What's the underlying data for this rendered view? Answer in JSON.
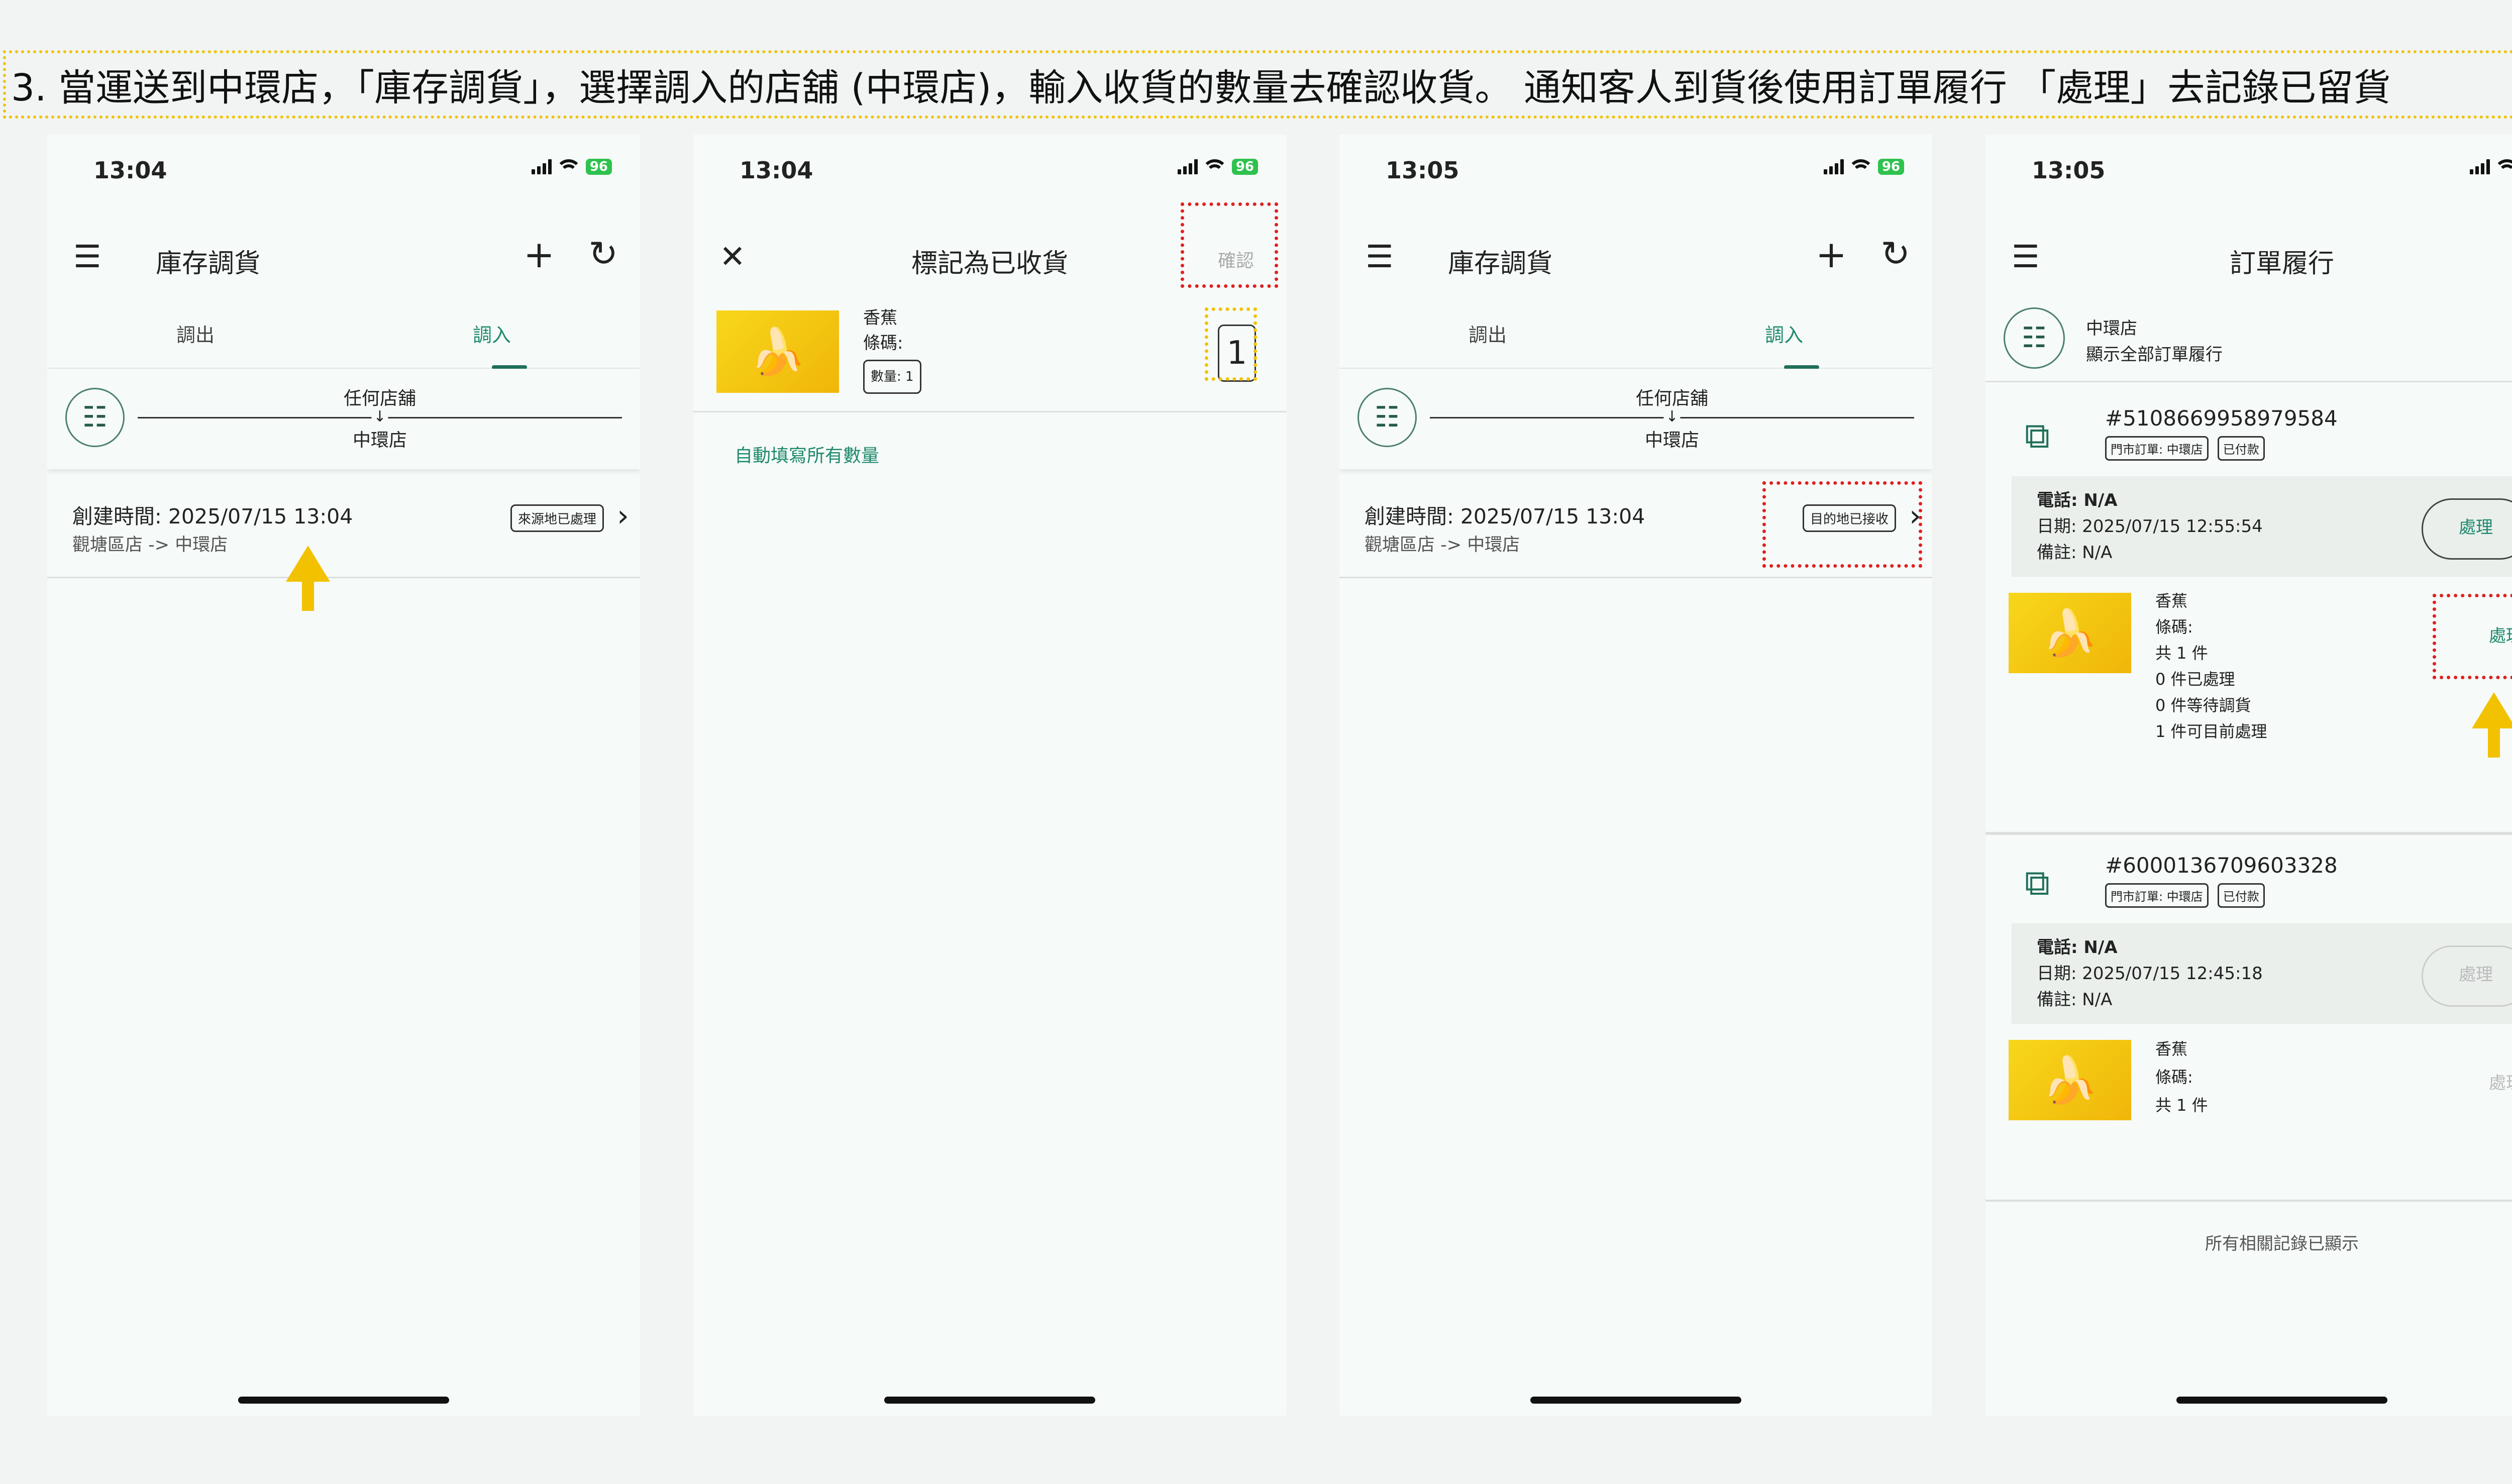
{
  "instruction": "3. 當運送到中環店，「庫存調貨」，選擇調入的店舖 (中環店)，輸入收貨的數量去確認收貨。 通知客人到貨後使用訂單履行 「處理」去記錄已留貨",
  "colors": {
    "accent": "#1f8a6e",
    "highlight_yellow": "#f2c200",
    "highlight_red": "#e02020",
    "battery": "#2fc24e"
  },
  "status": {
    "battery": "96",
    "icons": [
      "signal-icon",
      "wifi-icon",
      "battery-icon"
    ]
  },
  "phones": {
    "transfer_in": {
      "time": "13:04",
      "title": "庫存調貨",
      "tabs": [
        "調出",
        "調入"
      ],
      "active_tab": "調入",
      "filter_from": "任何店舖",
      "filter_to": "中環店",
      "record": {
        "created": "創建時間: 2025/07/15 13:04",
        "route": "觀塘區店 -> 中環店",
        "status_badge": "來源地已處理"
      }
    },
    "mark_received": {
      "time": "13:04",
      "title": "標記為已收貨",
      "confirm": "確認",
      "item": {
        "name": "香蕉",
        "barcode": "條碼:",
        "qty_badge": "數量: 1",
        "input_value": "1"
      },
      "autofill": "自動填寫所有數量"
    },
    "transfer_in_after": {
      "time": "13:05",
      "title": "庫存調貨",
      "tabs": [
        "調出",
        "調入"
      ],
      "active_tab": "調入",
      "filter_from": "任何店舖",
      "filter_to": "中環店",
      "record": {
        "created": "創建時間: 2025/07/15 13:04",
        "route": "觀塘區店 -> 中環店",
        "status_badge": "目的地已接收"
      }
    },
    "order_fulfillment": {
      "time": "13:05",
      "title": "訂單履行",
      "store": "中環店",
      "scope": "顯示全部訂單履行",
      "orders": [
        {
          "number": "#5108669958979584",
          "tags": [
            "門市訂單: 中環店",
            "已付款"
          ],
          "phone": "電話: N/A",
          "date": "日期: 2025/07/15 12:55:54",
          "note": "備註: N/A",
          "pill": "處理",
          "item": {
            "name": "香蕉",
            "barcode": "條碼:",
            "total": "共 1 件",
            "processed": "0 件已處理",
            "waiting": "0 件等待調貨",
            "available": "1 件可目前處理"
          },
          "item_action": "處理"
        },
        {
          "number": "#6000136709603328",
          "tags": [
            "門市訂單: 中環店",
            "已付款"
          ],
          "phone": "電話: N/A",
          "date": "日期: 2025/07/15 12:45:18",
          "note": "備註: N/A",
          "pill": "處理",
          "item": {
            "name": "香蕉",
            "barcode": "條碼:",
            "total": "共 1 件"
          },
          "item_action": "處理"
        }
      ],
      "footer": "所有相關記錄已顯示"
    }
  }
}
